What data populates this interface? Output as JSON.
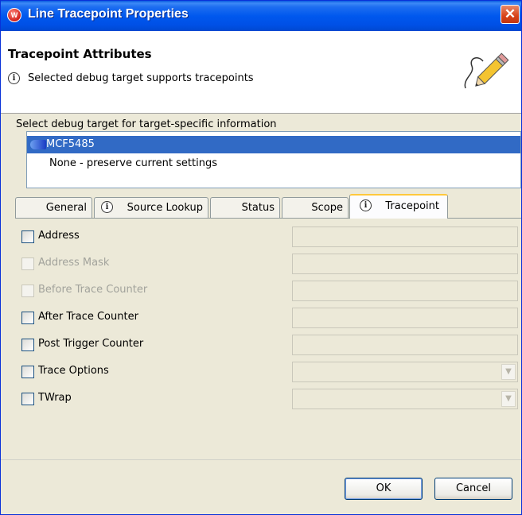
{
  "window": {
    "title": "Line Tracepoint Properties",
    "app_icon": "wind-river-icon",
    "close_glyph": "✕"
  },
  "header": {
    "title": "Tracepoint Attributes",
    "message": "Selected debug target supports tracepoints",
    "info_glyph": "i",
    "banner_icon": "pencil-icon"
  },
  "target": {
    "label": "Select debug target for target-specific information",
    "items": [
      {
        "label": "MCF5485",
        "selected": true
      },
      {
        "label": "None - preserve current settings",
        "selected": false
      }
    ]
  },
  "tabs": [
    {
      "label": "General",
      "icon": null,
      "active": false
    },
    {
      "label": "Source Lookup",
      "icon": "info-icon",
      "active": false
    },
    {
      "label": "Status",
      "icon": null,
      "active": false
    },
    {
      "label": "Scope",
      "icon": null,
      "active": false
    },
    {
      "label": "Tracepoint",
      "icon": "info-icon",
      "active": true
    }
  ],
  "fields": [
    {
      "label": "Address",
      "enabled": true,
      "checked": false,
      "control": "text",
      "value": ""
    },
    {
      "label": "Address Mask",
      "enabled": false,
      "checked": false,
      "control": "text",
      "value": ""
    },
    {
      "label": "Before Trace Counter",
      "enabled": false,
      "checked": false,
      "control": "text",
      "value": ""
    },
    {
      "label": "After Trace Counter",
      "enabled": true,
      "checked": false,
      "control": "text",
      "value": ""
    },
    {
      "label": "Post Trigger Counter",
      "enabled": true,
      "checked": false,
      "control": "text",
      "value": ""
    },
    {
      "label": "Trace Options",
      "enabled": true,
      "checked": false,
      "control": "combo",
      "value": ""
    },
    {
      "label": "TWrap",
      "enabled": true,
      "checked": false,
      "control": "combo",
      "value": ""
    }
  ],
  "buttons": {
    "ok": "OK",
    "cancel": "Cancel"
  },
  "colors": {
    "titlebar": "#0058ee",
    "selection": "#316ac5",
    "active_tab_accent": "#ffc83c",
    "dialog_bg": "#ece9d8"
  }
}
